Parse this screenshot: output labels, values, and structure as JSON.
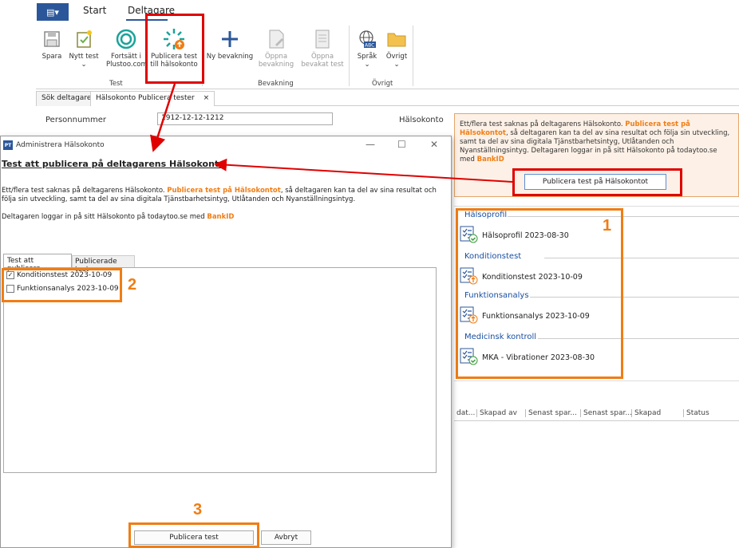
{
  "ribbon": {
    "tabs": [
      "Start",
      "Deltagare"
    ],
    "buttons": {
      "spara": "Spara",
      "nytt_test": "Nytt test",
      "fortsatt": "Fortsätt i Plustoo.com",
      "publicera": "Publicera test till hälsokonto",
      "ny_bevakning": "Ny bevakning",
      "oppna_bevakning": "Öppna bevakning",
      "oppna_bevakat_test": "Öppna bevakat test",
      "sprak": "Språk",
      "ovrigt": "Övrigt"
    },
    "groups": {
      "test": "Test",
      "bevakning": "Bevakning",
      "ovrigt": "Övrigt"
    }
  },
  "doc_tabs": [
    "Sök deltagare",
    "Hälsokonto Publicera tester"
  ],
  "form": {
    "personnummer_label": "Personnummer",
    "personnummer_value": "1912-12-12-1212",
    "halsokonto_label": "Hälsokonto"
  },
  "info_panel": {
    "text_a": "Ett/flera test saknas på deltagarens Hälsokonto. ",
    "text_highlight": "Publicera test på Hälsokontot",
    "text_b": ", så deltagaren kan ta del av sina resultat och följa sin utveckling, samt ta del av sina digitala Tjänstbarhetsintyg, Utlåtanden och Nyanställningsintyg. Deltagaren loggar in på sitt Hälsokonto på todaytoo.se med ",
    "text_bankid": "BankID",
    "button": "Publicera test på Hälsokontot"
  },
  "test_categories": [
    {
      "name": "Hälsoprofil",
      "item": "Hälsoprofil 2023-08-30",
      "status": "published"
    },
    {
      "name": "Konditionstest",
      "item": "Konditionstest 2023-10-09",
      "status": "pending"
    },
    {
      "name": "Funktionsanalys",
      "item": "Funktionsanalys 2023-10-09",
      "status": "pending"
    },
    {
      "name": "Medicinsk kontroll",
      "item": "MKA - Vibrationer 2023-08-30",
      "status": "published"
    }
  ],
  "grid_headers": [
    "dat...",
    "Skapad av",
    "Senast spar...",
    "Senast spar...",
    "Skapad",
    "Status"
  ],
  "dialog": {
    "title": "Administrera Hälsokonto",
    "heading": "Test att publicera på deltagarens Hälsokonto",
    "p1_a": "Ett/flera test saknas på deltagarens Hälsokonto. ",
    "p1_highlight": "Publicera test på Hälsokontot",
    "p1_b": ", så deltagaren kan ta del av sina resultat och följa sin utveckling, samt ta del av sina digitala Tjänstbarhetsintyg, Utlåtanden och Nyanställningsintyg.",
    "p2_a": "Deltagaren loggar in på sitt Hälsokonto på todaytoo.se med ",
    "p2_bankid": "BankID",
    "tabs": [
      "Test att publicera",
      "Publicerade test"
    ],
    "items": [
      {
        "label": "Konditionstest 2023-10-09",
        "checked": true
      },
      {
        "label": "Funktionsanalys 2023-10-09",
        "checked": false
      }
    ],
    "publish_button": "Publicera test",
    "cancel_button": "Avbryt"
  },
  "callouts": [
    "1",
    "2",
    "3"
  ],
  "colors": {
    "accent": "#f07d14",
    "highlight_red": "#e00000",
    "brand": "#2b579a",
    "link_blue": "#1a4fa3"
  }
}
